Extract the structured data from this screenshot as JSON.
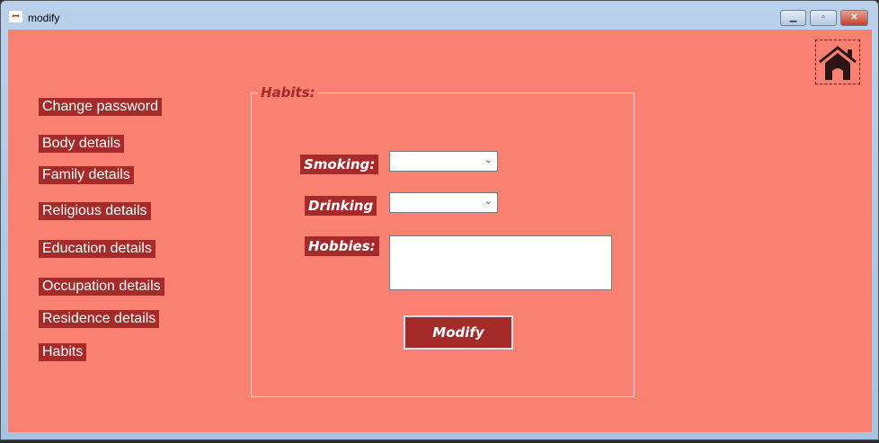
{
  "window": {
    "title": "modify",
    "icon": "app-icon",
    "controls": {
      "minimize": "▁",
      "maximize": "▫",
      "close": "✕"
    }
  },
  "nav": [
    {
      "label": "Change password"
    },
    {
      "label": "Body details"
    },
    {
      "label": "Family details"
    },
    {
      "label": "Religious details"
    },
    {
      "label": "Education details"
    },
    {
      "label": "Occupation details"
    },
    {
      "label": "Residence details"
    },
    {
      "label": "Habits"
    }
  ],
  "group": {
    "legend": "Habits:"
  },
  "form": {
    "smoking_label": "Smoking:",
    "smoking_value": "",
    "drinking_label": "Drinking",
    "drinking_value": "",
    "hobbies_label": "Hobbies:",
    "hobbies_value": "",
    "submit": "Modify"
  },
  "colors": {
    "background": "#FA8072",
    "accent": "#A52A2A"
  }
}
